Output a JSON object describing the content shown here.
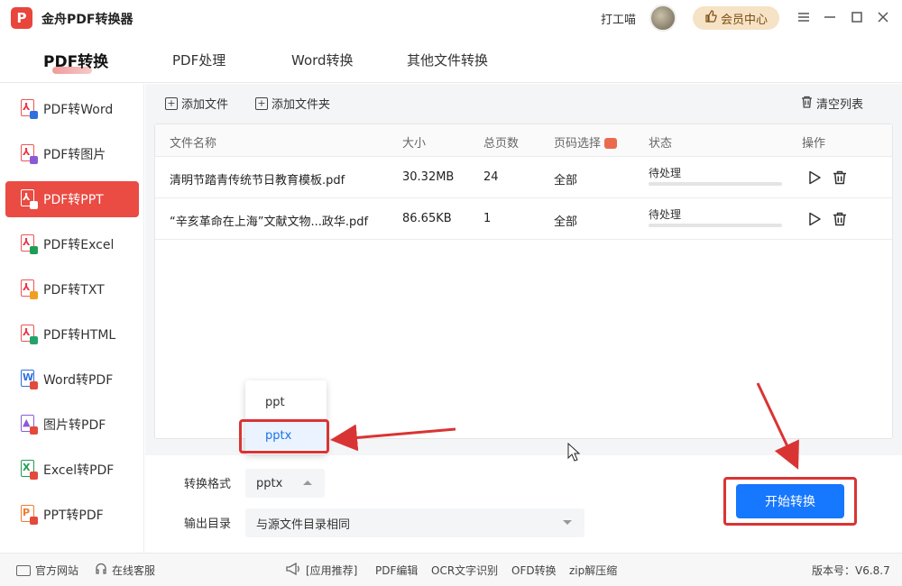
{
  "app": {
    "logo_glyph": "P",
    "title": "金舟PDF转换器",
    "username": "打工喵",
    "vip_label": "会员中心"
  },
  "tabs": [
    {
      "label": "PDF转换",
      "active": true
    },
    {
      "label": "PDF处理"
    },
    {
      "label": "Word转换"
    },
    {
      "label": "其他文件转换"
    }
  ],
  "sidebar": {
    "items": [
      {
        "label": "PDF转Word",
        "glyph": "⅄",
        "badge_color": "#2f6fe0"
      },
      {
        "label": "PDF转图片",
        "glyph": "⅄",
        "badge_color": "#8a5ad6"
      },
      {
        "label": "PDF转PPT",
        "glyph": "⅄",
        "badge_color": "#ffffff",
        "active": true
      },
      {
        "label": "PDF转Excel",
        "glyph": "⅄",
        "badge_color": "#1f9d55"
      },
      {
        "label": "PDF转TXT",
        "glyph": "⅄",
        "badge_color": "#f0a020"
      },
      {
        "label": "PDF转HTML",
        "glyph": "⅄",
        "badge_color": "#23a36b"
      },
      {
        "label": "Word转PDF",
        "glyph": "W",
        "badge_color": "#e34a3c"
      },
      {
        "label": "图片转PDF",
        "glyph": "▲",
        "badge_color": "#e34a3c"
      },
      {
        "label": "Excel转PDF",
        "glyph": "X",
        "badge_color": "#e34a3c"
      },
      {
        "label": "PPT转PDF",
        "glyph": "P",
        "badge_color": "#e34a3c"
      }
    ]
  },
  "toolbar": {
    "add_file": "添加文件",
    "add_folder": "添加文件夹",
    "clear_list": "清空列表"
  },
  "table": {
    "headers": {
      "name": "文件名称",
      "size": "大小",
      "pages": "总页数",
      "page_select": "页码选择",
      "status": "状态",
      "action": "操作"
    },
    "rows": [
      {
        "name": "清明节踏青传统节日教育模板.pdf",
        "size": "30.32MB",
        "pages": "24",
        "page_select": "全部",
        "status": "待处理",
        "progress": 0
      },
      {
        "name": "“辛亥革命在上海”文献文物...政华.pdf",
        "size": "86.65KB",
        "pages": "1",
        "page_select": "全部",
        "status": "待处理",
        "progress": 0
      }
    ]
  },
  "settings": {
    "format_label": "转换格式",
    "format_value": "pptx",
    "output_label": "输出目录",
    "output_value": "与源文件目录相同",
    "format_options": [
      "ppt",
      "pptx"
    ],
    "selected_option": "pptx"
  },
  "start_button": "开始转换",
  "statusbar": {
    "website": "官方网站",
    "support": "在线客服",
    "apps": "[应用推荐]",
    "links": [
      "PDF编辑",
      "OCR文字识别",
      "OFD转换",
      "zip解压缩"
    ],
    "version": "版本号：V6.8.7"
  },
  "colors": {
    "accent_red": "#ea4b42",
    "primary_blue": "#1677ff",
    "annotation_red": "#d93434"
  }
}
